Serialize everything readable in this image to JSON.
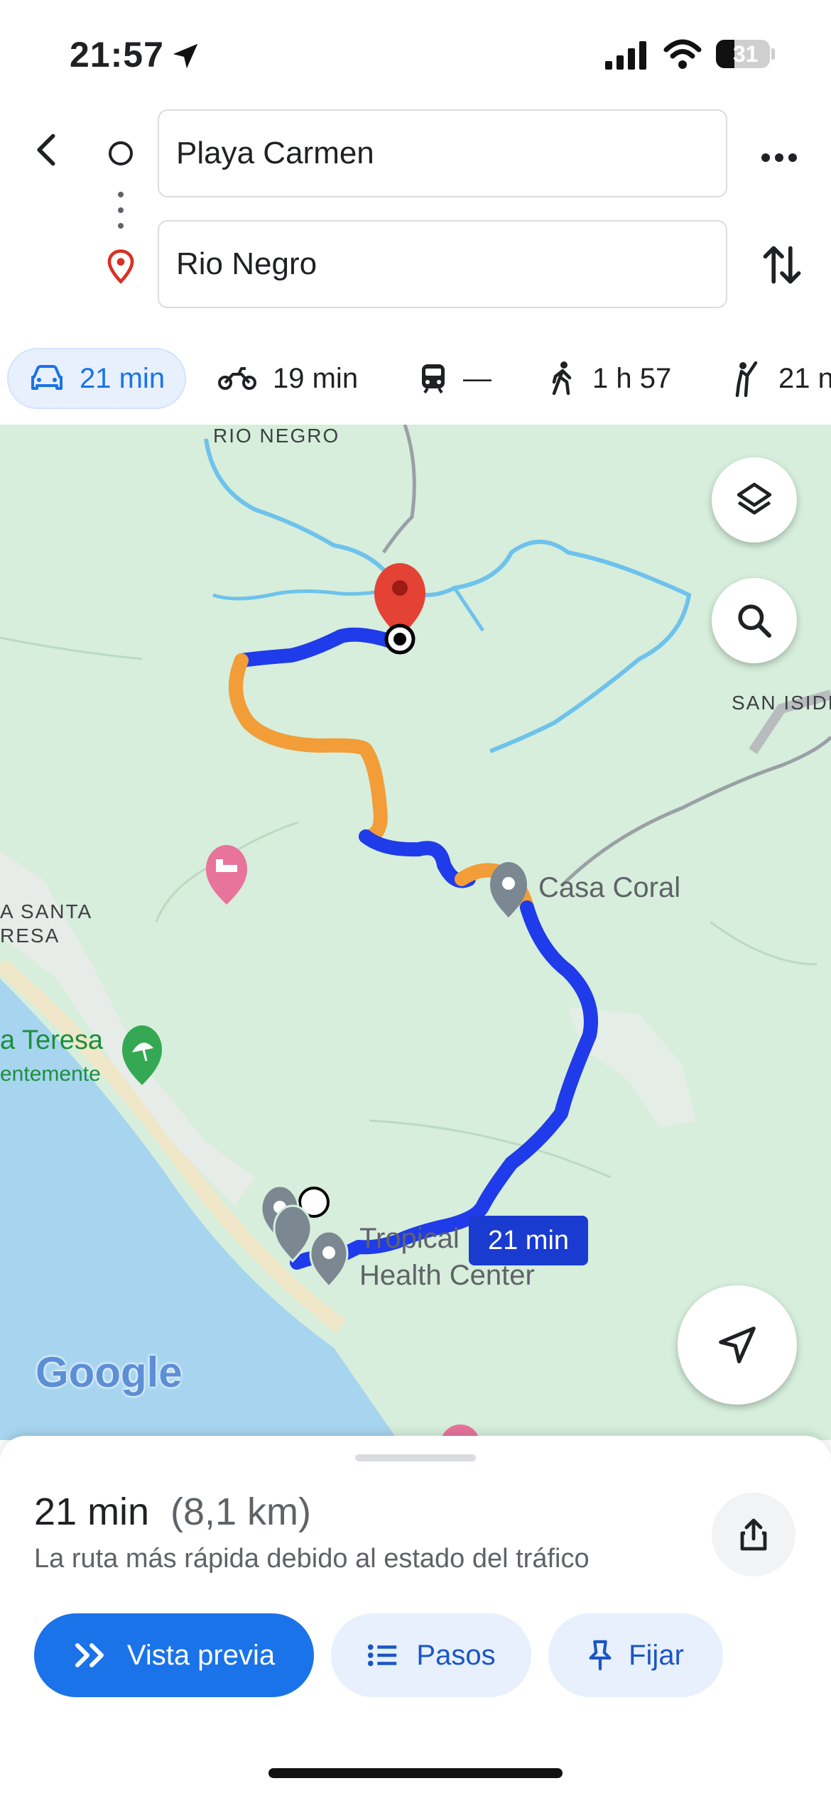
{
  "status_bar": {
    "time": "21:57",
    "battery": "31"
  },
  "header": {
    "origin": "Playa Carmen",
    "destination": "Rio Negro"
  },
  "modes": [
    {
      "name": "car",
      "label": "21 min",
      "active": true
    },
    {
      "name": "motorcycle",
      "label": "19 min"
    },
    {
      "name": "transit",
      "label": "—"
    },
    {
      "name": "walk",
      "label": "1 h 57"
    },
    {
      "name": "ride",
      "label": "21 n"
    }
  ],
  "map": {
    "labels": {
      "rio_negro": "RIO NEGRO",
      "san_isidro": "SAN ISIDR",
      "santa_teresa_upper_1": "A SANTA",
      "santa_teresa_upper_2": "RESA",
      "santa_teresa": "a Teresa",
      "santa_teresa_sub": "entemente",
      "casa_coral": "Casa Coral",
      "tropical_1": "Tropical",
      "tropical_2": "Health Center",
      "route_badge": "21 min",
      "google": "Google"
    },
    "colors": {
      "route_fast": "#1f3bea",
      "route_slow": "#f29d38",
      "water": "#a7d5f0",
      "land": "#d6eedb",
      "river": "#6ec2ec",
      "pin_red": "#e34234",
      "pin_gray": "#7b8791"
    }
  },
  "sheet": {
    "duration": "21 min",
    "distance": "(8,1 km)",
    "note": "La ruta más rápida debido al estado del tráfico",
    "preview_label": "Vista previa",
    "steps_label": "Pasos",
    "pin_label": "Fijar"
  }
}
